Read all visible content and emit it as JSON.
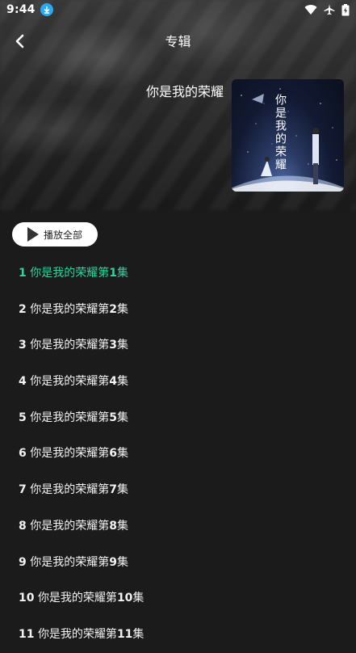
{
  "status": {
    "time": "9:44"
  },
  "header": {
    "title": "专辑",
    "back_icon": "chevron-left-icon"
  },
  "album": {
    "title": "你是我的荣耀",
    "cover_text": "你是我的荣耀"
  },
  "play_all_label": "播放全部",
  "colors": {
    "accent": "#2ed3a0",
    "background": "#1b1b1b"
  },
  "episodes": [
    {
      "number": "1",
      "prefix": "你是我的荣耀第",
      "ep": "1",
      "suffix": "集",
      "active": true
    },
    {
      "number": "2",
      "prefix": "你是我的荣耀第",
      "ep": "2",
      "suffix": "集"
    },
    {
      "number": "3",
      "prefix": "你是我的荣耀第",
      "ep": "3",
      "suffix": "集"
    },
    {
      "number": "4",
      "prefix": "你是我的荣耀第",
      "ep": "4",
      "suffix": "集"
    },
    {
      "number": "5",
      "prefix": "你是我的荣耀第",
      "ep": "5",
      "suffix": "集"
    },
    {
      "number": "6",
      "prefix": "你是我的荣耀第",
      "ep": "6",
      "suffix": "集"
    },
    {
      "number": "7",
      "prefix": "你是我的荣耀第",
      "ep": "7",
      "suffix": "集"
    },
    {
      "number": "8",
      "prefix": "你是我的荣耀第",
      "ep": "8",
      "suffix": "集"
    },
    {
      "number": "9",
      "prefix": "你是我的荣耀第",
      "ep": "9",
      "suffix": "集"
    },
    {
      "number": "10",
      "prefix": "你是我的荣耀第",
      "ep": "10",
      "suffix": "集"
    },
    {
      "number": "11",
      "prefix": "你是我的荣耀第",
      "ep": "11",
      "suffix": "集"
    }
  ]
}
